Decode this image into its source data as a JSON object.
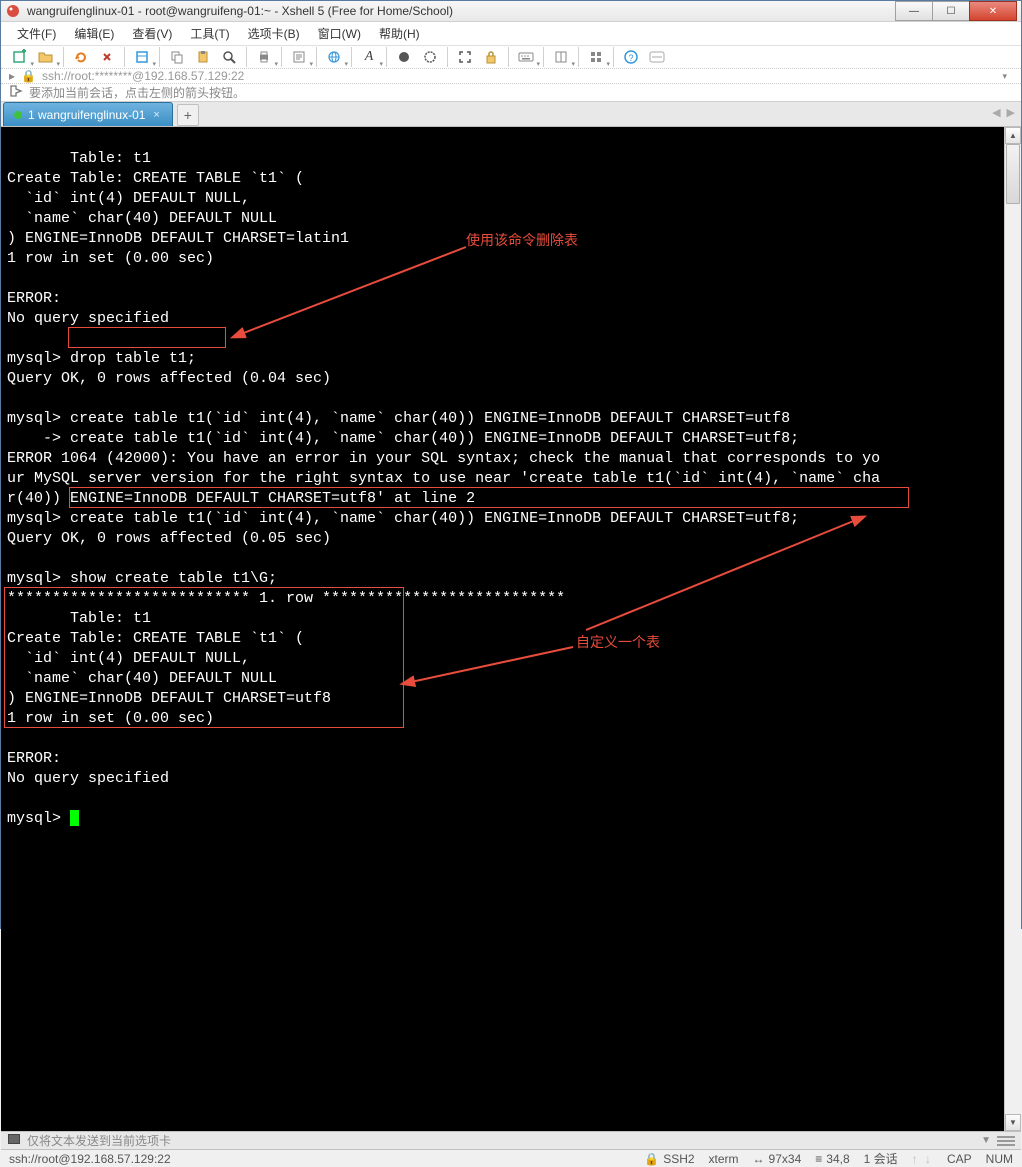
{
  "window": {
    "title": "wangruifenglinux-01 - root@wangruifeng-01:~ - Xshell 5 (Free for Home/School)"
  },
  "menu": {
    "file": "文件(F)",
    "edit": "编辑(E)",
    "view": "查看(V)",
    "tools": "工具(T)",
    "tabs": "选项卡(B)",
    "window": "窗口(W)",
    "help": "帮助(H)"
  },
  "address": {
    "text": "ssh://root:********@192.168.57.129:22"
  },
  "infobar": {
    "text": "要添加当前会话，点击左侧的箭头按钮。"
  },
  "tab": {
    "label": "1 wangruifenglinux-01"
  },
  "terminal": {
    "l1": "       Table: t1",
    "l2": "Create Table: CREATE TABLE `t1` (",
    "l3": "  `id` int(4) DEFAULT NULL,",
    "l4": "  `name` char(40) DEFAULT NULL",
    "l5": ") ENGINE=InnoDB DEFAULT CHARSET=latin1",
    "l6": "1 row in set (0.00 sec)",
    "l7": "",
    "l8": "ERROR:",
    "l9": "No query specified",
    "l10": "",
    "l11": "mysql> drop table t1;",
    "l12": "Query OK, 0 rows affected (0.04 sec)",
    "l13": "",
    "l14": "mysql> create table t1(`id` int(4), `name` char(40)) ENGINE=InnoDB DEFAULT CHARSET=utf8",
    "l15": "    -> create table t1(`id` int(4), `name` char(40)) ENGINE=InnoDB DEFAULT CHARSET=utf8;",
    "l16": "ERROR 1064 (42000): You have an error in your SQL syntax; check the manual that corresponds to yo",
    "l17": "ur MySQL server version for the right syntax to use near 'create table t1(`id` int(4), `name` cha",
    "l18": "r(40)) ENGINE=InnoDB DEFAULT CHARSET=utf8' at line 2",
    "l19": "mysql> create table t1(`id` int(4), `name` char(40)) ENGINE=InnoDB DEFAULT CHARSET=utf8;",
    "l20": "Query OK, 0 rows affected (0.05 sec)",
    "l21": "",
    "l22": "mysql> show create table t1\\G;",
    "l23": "*************************** 1. row ***************************",
    "l24": "       Table: t1",
    "l25": "Create Table: CREATE TABLE `t1` (",
    "l26": "  `id` int(4) DEFAULT NULL,",
    "l27": "  `name` char(40) DEFAULT NULL",
    "l28": ") ENGINE=InnoDB DEFAULT CHARSET=utf8",
    "l29": "1 row in set (0.00 sec)",
    "l30": "",
    "l31": "ERROR:",
    "l32": "No query specified",
    "l33": "",
    "l34": "mysql> "
  },
  "annotations": {
    "a1": "使用该命令删除表",
    "a2": "自定义一个表"
  },
  "inputbar": {
    "hint": "仅将文本发送到当前选项卡"
  },
  "status": {
    "conn": "ssh://root@192.168.57.129:22",
    "ssh": "SSH2",
    "term": "xterm",
    "size": "97x34",
    "pos": "34,8",
    "sessions": "1 会话",
    "cap": "CAP",
    "num": "NUM"
  }
}
